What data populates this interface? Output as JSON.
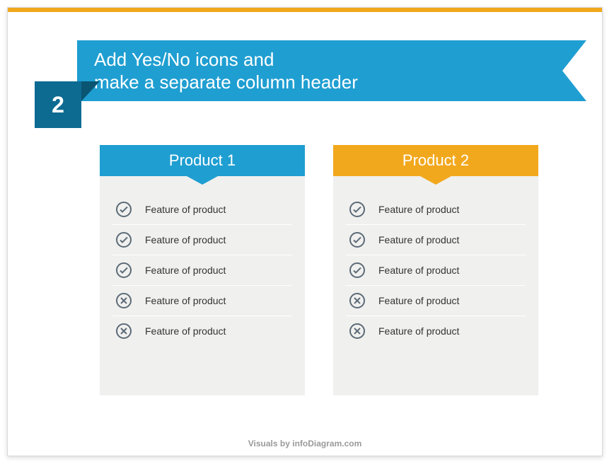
{
  "step_number": "2",
  "title_line1": "Add Yes/No icons and",
  "title_line2": "make a separate column header",
  "columns": [
    {
      "name": "Product 1",
      "color": "blue",
      "features": [
        {
          "ok": true,
          "text": "Feature of product"
        },
        {
          "ok": true,
          "text": "Feature of product"
        },
        {
          "ok": true,
          "text": "Feature of product"
        },
        {
          "ok": false,
          "text": "Feature of product"
        },
        {
          "ok": false,
          "text": "Feature of product"
        }
      ]
    },
    {
      "name": "Product 2",
      "color": "orange",
      "features": [
        {
          "ok": true,
          "text": "Feature of product"
        },
        {
          "ok": true,
          "text": "Feature of product"
        },
        {
          "ok": true,
          "text": "Feature of product"
        },
        {
          "ok": false,
          "text": "Feature of product"
        },
        {
          "ok": false,
          "text": "Feature of product"
        }
      ]
    }
  ],
  "footer": "Visuals by infoDiagram.com"
}
